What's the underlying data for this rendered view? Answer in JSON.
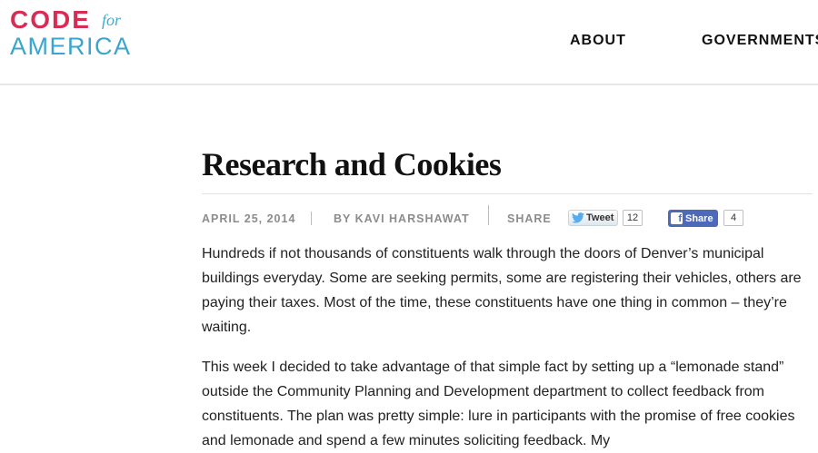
{
  "header": {
    "logo": {
      "line1": "CODE",
      "for": "for",
      "line2": "AMERICA"
    },
    "nav": {
      "about": "ABOUT",
      "governments": "GOVERNMENTS"
    }
  },
  "article": {
    "title": "Research and Cookies",
    "date": "APRIL 25, 2014",
    "author": "BY KAVI HARSHAWAT",
    "share_label": "SHARE",
    "tweet_label": "Tweet",
    "tweet_count": "12",
    "fb_label": "Share",
    "fb_count": "4",
    "paragraphs": [
      "Hundreds if not thousands of constituents walk through the doors of Denver’s municipal buildings everyday. Some are seeking permits, some are registering their vehicles, others are paying their taxes. Most of the time, these constituents have one thing in common – they’re waiting.",
      "This week I decided to take advantage of that simple fact by setting up a “lemonade stand” outside the Community Planning and Development department to collect feedback from constituents. The plan was pretty simple: lure in participants with the promise of free cookies and lemonade and spend a few minutes soliciting feedback. My"
    ]
  },
  "colors": {
    "brand_red": "#d62d54",
    "brand_blue": "#3ba4cf",
    "facebook_blue": "#4c69ba",
    "twitter_blue": "#55acee"
  },
  "icons": [
    "twitter-bird-icon",
    "facebook-f-icon"
  ]
}
